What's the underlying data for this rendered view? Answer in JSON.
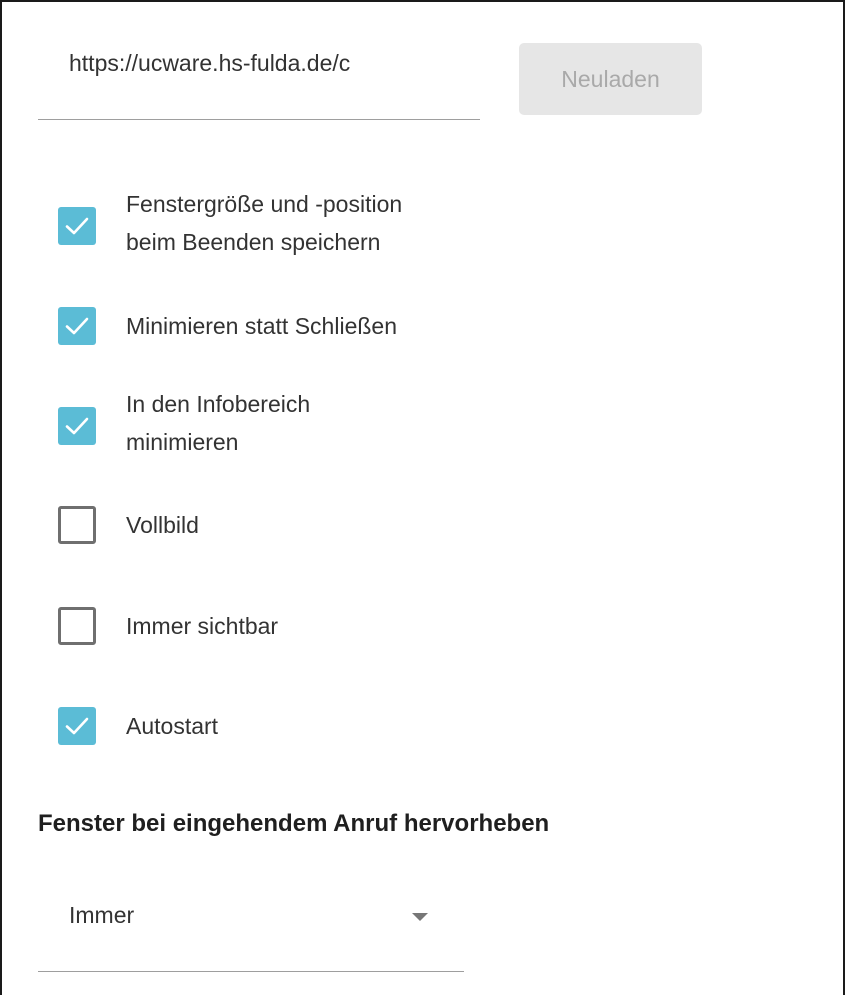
{
  "server": {
    "url_value": "https://ucware.hs-fulda.de/c",
    "reload_label": "Neuladen"
  },
  "options": [
    {
      "label": "Fenstergröße und -position\nbeim Beenden speichern",
      "checked": true
    },
    {
      "label": "Minimieren statt Schließen",
      "checked": true
    },
    {
      "label": "In den Infobereich\nminimieren",
      "checked": true
    },
    {
      "label": "Vollbild",
      "checked": false
    },
    {
      "label": "Immer sichtbar",
      "checked": false
    },
    {
      "label": "Autostart",
      "checked": true
    }
  ],
  "highlight": {
    "title": "Fenster bei eingehendem Anruf hervorheben",
    "selected": "Immer"
  },
  "colors": {
    "checkbox_checked": "#5bbcd6",
    "checkbox_unchecked_border": "#6f6f6f",
    "button_bg": "#e6e6e6",
    "button_text": "#a9a9a9"
  },
  "icons": {
    "check": "check-icon",
    "dropdown": "chevron-down-icon"
  }
}
